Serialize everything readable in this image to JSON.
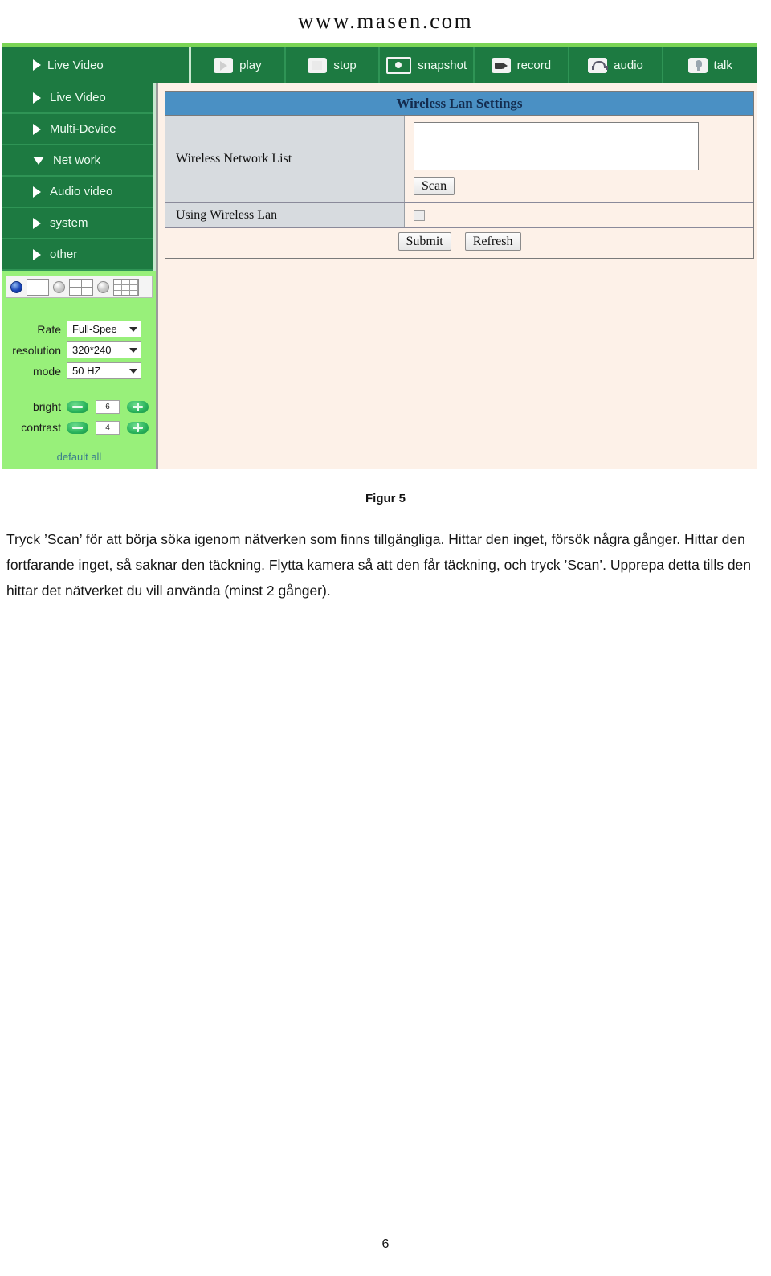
{
  "banner": {
    "site": "www.masen.com"
  },
  "toolbar": {
    "home_label": "Live Video",
    "buttons": [
      {
        "label": "play",
        "icon": "play-icon"
      },
      {
        "label": "stop",
        "icon": "stop-icon"
      },
      {
        "label": "snapshot",
        "icon": "snapshot-icon"
      },
      {
        "label": "record",
        "icon": "record-icon"
      },
      {
        "label": "audio",
        "icon": "audio-icon"
      },
      {
        "label": "talk",
        "icon": "talk-icon"
      }
    ]
  },
  "sidebar": {
    "items": [
      {
        "label": "Live Video",
        "state": "collapsed"
      },
      {
        "label": "Multi-Device",
        "state": "collapsed"
      },
      {
        "label": "Net work",
        "state": "expanded"
      },
      {
        "label": "Audio video",
        "state": "collapsed"
      },
      {
        "label": "system",
        "state": "collapsed"
      },
      {
        "label": "other",
        "state": "collapsed"
      }
    ],
    "view_modes": [
      {
        "name": "single-pane",
        "selected": true
      },
      {
        "name": "four-pane",
        "selected": false
      },
      {
        "name": "nine-pane",
        "selected": false
      }
    ],
    "controls": [
      {
        "label": "Rate",
        "value": "Full-Spee"
      },
      {
        "label": "resolution",
        "value": "320*240"
      },
      {
        "label": "mode",
        "value": "50 HZ"
      }
    ],
    "adjustments": [
      {
        "label": "bright",
        "value": "6"
      },
      {
        "label": "contrast",
        "value": "4"
      }
    ],
    "default_all": "default all"
  },
  "panel": {
    "title": "Wireless Lan Settings",
    "network_list_label": "Wireless Network List",
    "network_list_value": "",
    "scan_button": "Scan",
    "using_wireless_label": "Using Wireless Lan",
    "using_wireless_checked": false,
    "submit_button": "Submit",
    "refresh_button": "Refresh"
  },
  "figure": {
    "caption": "Figur 5",
    "body": "Tryck ’Scan’ för att börja söka igenom nätverken som finns tillgängliga. Hittar den inget, försök några gånger. Hittar den fortfarande inget, så saknar den täckning. Flytta kamera så att den får täckning, och tryck ’Scan’. Upprepa detta tills den hittar det nätverket du vill använda (minst 2 gånger)."
  },
  "page": {
    "number": "6"
  },
  "colors": {
    "nav_green": "#1d7a41",
    "panel_green": "#98f07a",
    "header_blue": "#4a90c4",
    "content_cream": "#fdf1e8",
    "label_gray": "#d7dbdf"
  }
}
